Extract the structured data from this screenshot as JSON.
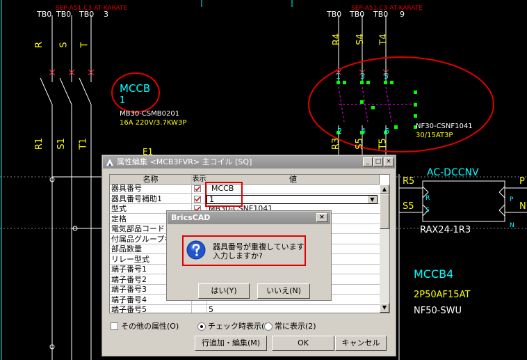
{
  "cad": {
    "top_labels": [
      "TB0",
      "TB0",
      "TB0",
      "3",
      "TB0",
      "TB0",
      "TB0",
      "9"
    ],
    "red_header": [
      "SEP-A51.C3-AT-KARATE",
      "SEP-A51.C3-AT-KARATE"
    ],
    "phase_top": [
      "R",
      "S",
      "T"
    ],
    "phase_top_right": [
      "R4",
      "S4",
      "T4"
    ],
    "phase_bottom": [
      "R1",
      "S1",
      "T1"
    ],
    "phase_bottom_right": [
      "R3",
      "S5",
      "T5"
    ],
    "mccb_name": "MCCB",
    "mccb_index": "1",
    "mccb_model": "MB30-CSMB0201",
    "mccb_spec": "16A 220V/3.7KW3P",
    "contactor_terminals": [
      "1",
      "3",
      "5",
      "2",
      "4",
      "6"
    ],
    "contactor_model": "NF30-CSNF1041",
    "contactor_spec": "30/15AT3P",
    "relay_label": "E1",
    "ac_box_label": "AC-DCCNV",
    "ac_in": [
      "R5",
      "S5"
    ],
    "ac_pins": [
      "R",
      "S",
      "P",
      "N"
    ],
    "ac_out": [
      "P",
      "N"
    ],
    "ac_model": "RAX24-1R3",
    "mccb4_name": "MCCB4",
    "mccb4_spec": "2P50AF15AT",
    "mccb4_model": "NF50-SWU"
  },
  "attr_dialog": {
    "title": "属性編集 <MCB3FVR> 主コイル [SQ]",
    "columns": {
      "name": "名称",
      "show": "表示",
      "value": "値"
    },
    "rows": [
      {
        "name": "器具番号",
        "shown": true,
        "value": "MCCB"
      },
      {
        "name": "器具番号補助1",
        "shown": true,
        "value": "1"
      },
      {
        "name": "型式",
        "shown": true,
        "value": "MB30-CSNF1041"
      },
      {
        "name": "定格",
        "shown": true,
        "value": ""
      },
      {
        "name": "電気部品コード",
        "shown": false,
        "value": ""
      },
      {
        "name": "付属品グループ名",
        "shown": false,
        "value": ""
      },
      {
        "name": "部品数量",
        "shown": false,
        "value": ""
      },
      {
        "name": "リレー型式",
        "shown": false,
        "value": ""
      },
      {
        "name": "端子番号1",
        "shown": false,
        "value": ""
      },
      {
        "name": "端子番号2",
        "shown": false,
        "value": ""
      },
      {
        "name": "端子番号3",
        "shown": false,
        "value": ""
      },
      {
        "name": "端子番号4",
        "shown": false,
        "value": ""
      },
      {
        "name": "端子番号5",
        "shown": false,
        "value": "5"
      }
    ],
    "other_attrs_label": "その他の属性(O)",
    "radio_check_label": "チェック時表示(1)",
    "radio_always_label": "常に表示(2)",
    "add_edit_button": "行追加・編集(M)",
    "ok_button": "OK",
    "cancel_button": "キャンセル"
  },
  "msgbox": {
    "title": "BricsCAD",
    "line1": "器具番号が重複しています",
    "line2": "入力しますか?",
    "yes_button": "はい(Y)",
    "no_button": "いいえ(N)"
  },
  "colors": {
    "cad_white": "#ffffff",
    "cad_yellow": "#ffff00",
    "cad_cyan": "#00ffff",
    "cad_magenta": "#ff00ff",
    "cad_green": "#00ff00",
    "annotation_red": "#e00000",
    "dialog_face": "#d4d0c8"
  }
}
